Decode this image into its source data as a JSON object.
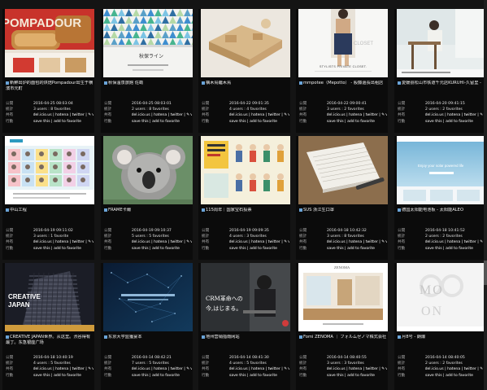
{
  "labels": {
    "date": "公開",
    "stats": "統計",
    "share": "共有",
    "action": "行動",
    "save_action": "save this | add to favorite",
    "share_links": "del.icio.us | hatena | twitter | ✎↘"
  },
  "cards": [
    {
      "title": "新鮮出炉的面包的烘焙Pompadour出生于横濱市元町",
      "date": "2016-04-25 08:03:04",
      "stats": "3 users : 8 favorites"
    },
    {
      "title": "秋保温泉旅館 佐勘",
      "date": "2016-04-25 08:03:01",
      "stats": "2 users : 8 favorites"
    },
    {
      "title": "橫木鳥繼木鳥",
      "date": "2016-04-22 09:01:35",
      "stats": "4 users : 4 favorites"
    },
    {
      "title": "mmpotee（Mepotto） - 股藤還長出租店",
      "date": "2016-04-22 09:00:41",
      "stats": "3 users : 2 favorites"
    },
    {
      "title": "愛媛县松山市铁道千元店KURUHI-久留里 -",
      "date": "2016-04-20 09:41:15",
      "stats": "2 users : 2 favorites"
    },
    {
      "title": "中山工程",
      "date": "2016-04-19 09:11:02",
      "stats": "3 users : 1 favorite"
    },
    {
      "title": "FRAME卡爾",
      "date": "2016-04-19 09:10:37",
      "stats": "5 users : 5 favorites"
    },
    {
      "title": "115周年｜国家宝石投票",
      "date": "2016-04-19 09:09:35",
      "stats": "4 users : 3 favorites"
    },
    {
      "title": "SUS 浙江生口罩",
      "date": "2016-04-18 10:42:32",
      "stats": "3 users : 8 favorites"
    },
    {
      "title": "德国太阳能电池板 - 太阳能ALEO",
      "date": "2016-04-18 10:41:52",
      "stats": "2 users : 2 favorites"
    },
    {
      "title": "CREATIVE JAPAN世界。从这里。渋谷得有最丁。东急银座广场",
      "date": "2016-04-18 10:40:19",
      "stats": "4 users : 5 favorites"
    },
    {
      "title": "东京大学监獲宴本",
      "date": "2016-04-14 08:42:21",
      "stats": "7 users : 5 favorites"
    },
    {
      "title": "地州营销指南网站",
      "date": "2016-04-14 08:41:30",
      "stats": "4 users : 5 favorites"
    },
    {
      "title": "Fomi ZENOMA ｜ フォルムゼノマ株式会社",
      "date": "2016-04-14 08:40:55",
      "stats": "3 users : 3 favorites"
    },
    {
      "title": "月8号 - 朗爆",
      "date": "2016-04-14 08:40:05",
      "stats": "2 users : 2 favorites"
    }
  ],
  "thumb_texts": {
    "t0": "POMPADOUR",
    "t1": "秋保ライン",
    "t3": "STYLISTS PRIVATE CLOSET.",
    "t3b": "CLOSET",
    "t9": "Enjoy your solar powered life",
    "t10": "CREATIVE JAPAN",
    "t12": "CRM革命への 今,はじまる。",
    "t13": "ZENOMA",
    "t14": "MOON"
  }
}
